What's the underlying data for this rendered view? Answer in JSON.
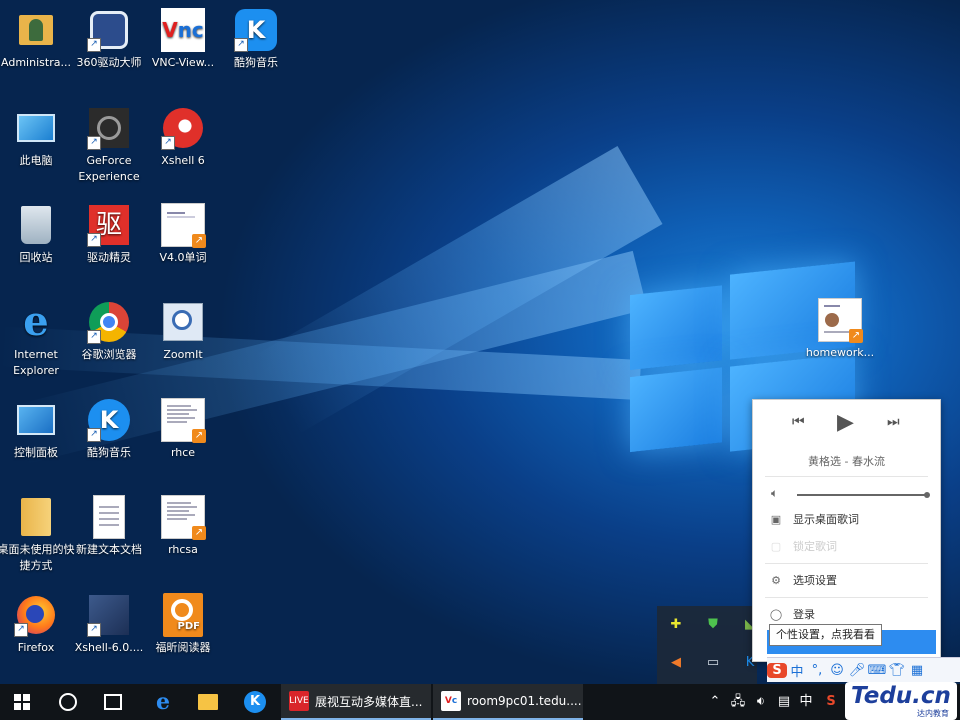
{
  "desktop_icons": [
    {
      "label": "Administra...",
      "icon": "user-folder-icon"
    },
    {
      "label": "360驱动大师",
      "icon": "360-driver-icon"
    },
    {
      "label": "VNC-View...",
      "icon": "vnc-viewer-icon"
    },
    {
      "label": "酷狗音乐",
      "icon": "kugou-icon"
    },
    {
      "label": "此电脑",
      "icon": "computer-icon"
    },
    {
      "label": "GeForce Experience",
      "icon": "geforce-icon"
    },
    {
      "label": "Xshell 6",
      "icon": "xshell-icon"
    },
    {
      "label": "回收站",
      "icon": "recycle-bin-icon"
    },
    {
      "label": "驱动精灵",
      "icon": "driver-genius-icon"
    },
    {
      "label": "V4.0单词",
      "icon": "document-icon"
    },
    {
      "label": "Internet Explorer",
      "icon": "ie-icon"
    },
    {
      "label": "谷歌浏览器",
      "icon": "chrome-icon"
    },
    {
      "label": "ZoomIt",
      "icon": "zoomit-icon"
    },
    {
      "label": "控制面板",
      "icon": "control-panel-icon"
    },
    {
      "label": "酷狗音乐",
      "icon": "kugou-icon"
    },
    {
      "label": "rhce",
      "icon": "document-icon"
    },
    {
      "label": "桌面未使用的快捷方式",
      "icon": "folder-icon"
    },
    {
      "label": "新建文本文档",
      "icon": "text-file-icon"
    },
    {
      "label": "rhcsa",
      "icon": "document-icon"
    },
    {
      "label": "Firefox",
      "icon": "firefox-icon"
    },
    {
      "label": "Xshell-6.0....",
      "icon": "xshell-installer-icon"
    },
    {
      "label": "福昕阅读器",
      "icon": "foxit-pdf-icon"
    },
    {
      "label": "homework...",
      "icon": "document-icon"
    }
  ],
  "player_popup": {
    "song": "黄格选 - 春水流",
    "volume": 1.0,
    "menu": [
      {
        "label": "显示桌面歌词",
        "icon": "lyrics-icon",
        "enabled": true
      },
      {
        "label": "锁定歌词",
        "icon": "lock-icon",
        "enabled": false
      },
      {
        "label": "选项设置",
        "icon": "settings-icon",
        "enabled": true
      },
      {
        "label": "登录",
        "icon": "user-icon",
        "enabled": true
      }
    ]
  },
  "tooltip": "个性设置，点我看看",
  "ime_bar": {
    "mode": "中",
    "punct": "°,"
  },
  "taskbar": {
    "apps": [
      {
        "label": "展视互动多媒体直...",
        "icon": "live-icon",
        "color": "#d9252a"
      },
      {
        "label": "room9pc01.tedu....",
        "icon": "vnc-icon",
        "color": "#ffffff"
      }
    ],
    "ime_lang": "中"
  },
  "watermark": {
    "brand": "Tedu.cn",
    "sub": "达内教育"
  }
}
